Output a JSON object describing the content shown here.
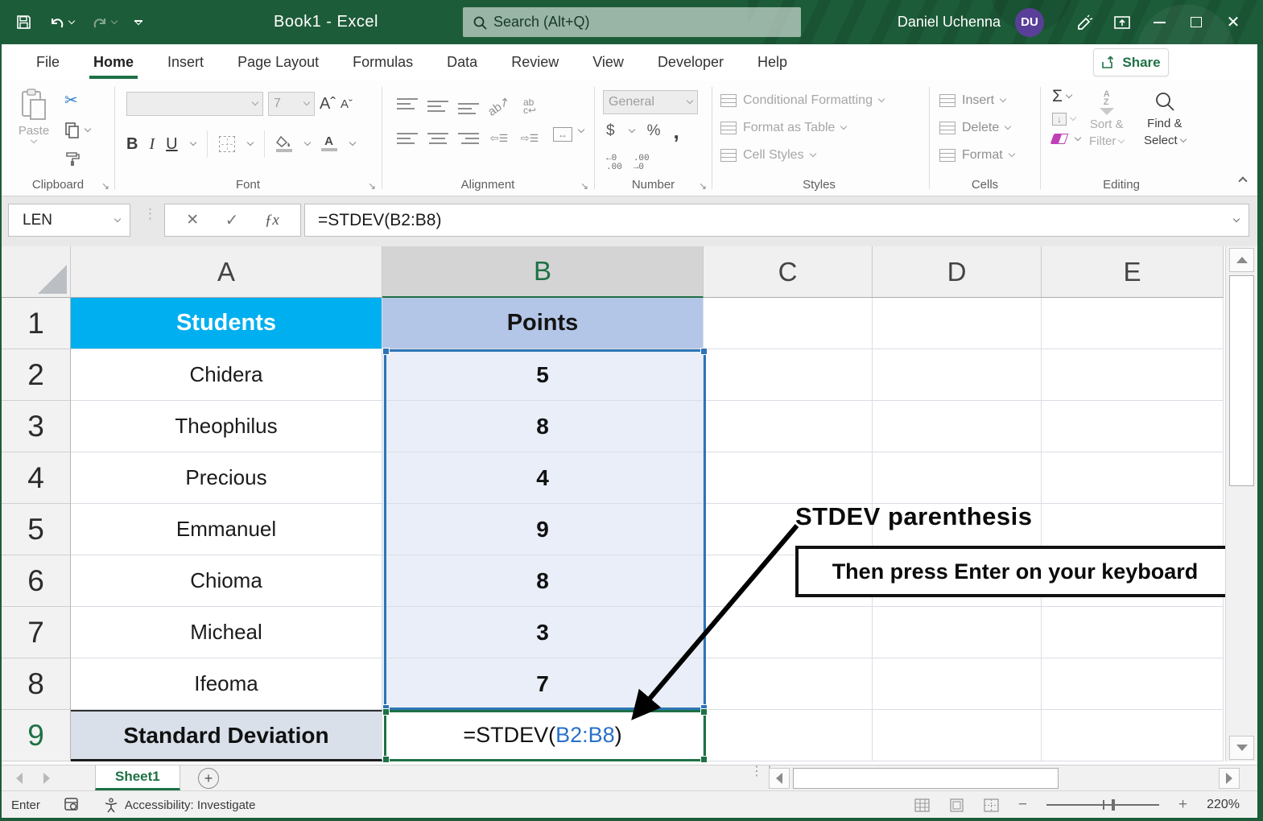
{
  "titlebar": {
    "title": "Book1  -  Excel",
    "search_placeholder": "Search (Alt+Q)",
    "user_name": "Daniel Uchenna",
    "user_initials": "DU"
  },
  "tabs": {
    "items": [
      "File",
      "Home",
      "Insert",
      "Page Layout",
      "Formulas",
      "Data",
      "Review",
      "View",
      "Developer",
      "Help"
    ],
    "active": "Home",
    "share_label": "Share"
  },
  "ribbon": {
    "clipboard": {
      "label": "Clipboard",
      "paste": "Paste"
    },
    "font": {
      "label": "Font",
      "size_value": "7"
    },
    "alignment": {
      "label": "Alignment",
      "wrap_line1": "ab",
      "wrap_line2": "c"
    },
    "number": {
      "label": "Number",
      "format_value": "General",
      "dollar": "$",
      "percent": "%",
      "comma": ",",
      "dec1a": "←0",
      "dec1b": ".00",
      "dec2a": ".00",
      "dec2b": "→0"
    },
    "styles": {
      "label": "Styles",
      "conditional_formatting": "Conditional Formatting",
      "format_as_table": "Format as Table",
      "cell_styles": "Cell Styles"
    },
    "cells": {
      "label": "Cells",
      "insert": "Insert",
      "delete": "Delete",
      "format": "Format"
    },
    "editing": {
      "label": "Editing",
      "autosum": "Σ",
      "sort_line1": "Sort &",
      "sort_line2": "Filter",
      "find_line1": "Find &",
      "find_line2": "Select"
    }
  },
  "formula_bar": {
    "name_box": "LEN",
    "formula": "=STDEV(B2:B8)"
  },
  "sheet": {
    "col_headers": [
      "A",
      "B",
      "C",
      "D",
      "E"
    ],
    "row_numbers": [
      "1",
      "2",
      "3",
      "4",
      "5",
      "6",
      "7",
      "8",
      "9"
    ],
    "header_row": {
      "students": "Students",
      "points": "Points"
    },
    "data_rows": [
      {
        "name": "Chidera",
        "points": "5"
      },
      {
        "name": "Theophilus",
        "points": "8"
      },
      {
        "name": "Precious",
        "points": "4"
      },
      {
        "name": "Emmanuel",
        "points": "9"
      },
      {
        "name": "Chioma",
        "points": "8"
      },
      {
        "name": "Micheal",
        "points": "3"
      },
      {
        "name": "Ifeoma",
        "points": "7"
      }
    ],
    "footer_row": {
      "label": "Standard Deviation",
      "formula_prefix": "=STDEV(",
      "formula_range": "B2:B8",
      "formula_suffix": ")"
    }
  },
  "annotation": {
    "heading": "STDEV parenthesis",
    "box_text": "Then press Enter on your keyboard"
  },
  "sheet_bar": {
    "active_tab": "Sheet1"
  },
  "status_bar": {
    "mode": "Enter",
    "accessibility": "Accessibility: Investigate",
    "zoom_level": "220%"
  },
  "colors": {
    "title_green": "#1D5C39",
    "accent_green": "#1E7145",
    "students_fill": "#00AFEF",
    "points_fill": "#B4C6E7",
    "range_fill": "#E9EEF8",
    "selection_blue": "#2E75B6",
    "footer_fill": "#D9E0EA",
    "reference_blue": "#2970C8",
    "avatar_purple": "#5A3F99"
  }
}
